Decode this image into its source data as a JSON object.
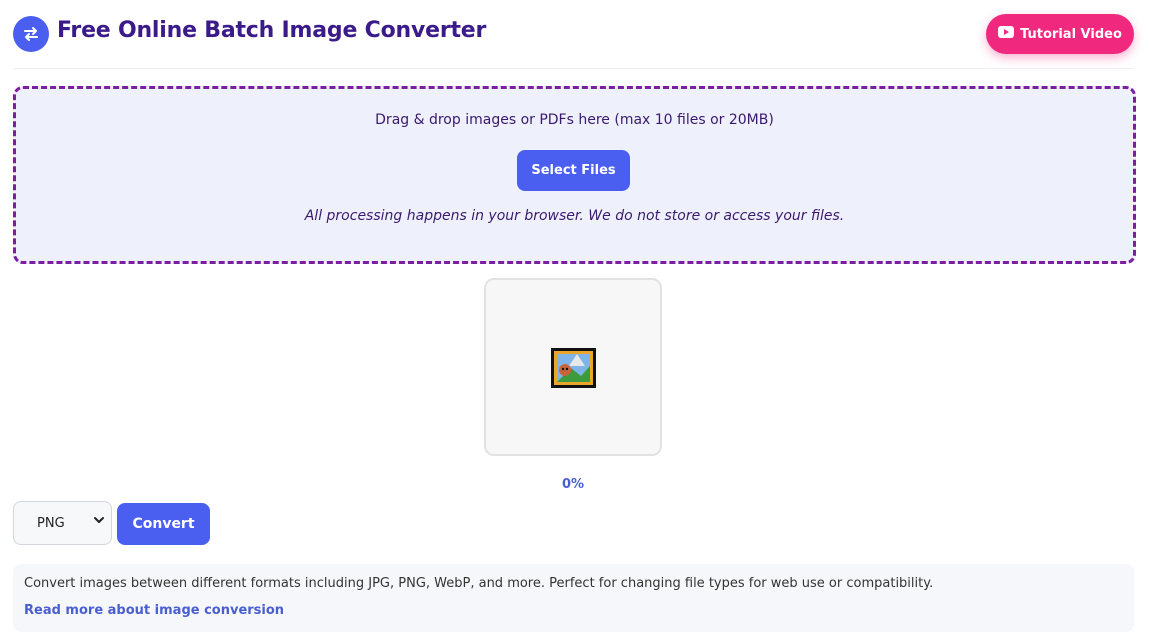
{
  "header": {
    "title": "Free Online Batch Image Converter",
    "tutorial_label": "Tutorial Video",
    "logo_icon": "swap-arrows-icon"
  },
  "dropzone": {
    "instruction": "Drag & drop images or PDFs here (max 10 files or 20MB)",
    "select_label": "Select Files",
    "privacy_note": "All processing happens in your browser. We do not store or access your files."
  },
  "preview": {
    "icon": "broken-image-icon",
    "progress_percent": 0,
    "progress_text": "0%"
  },
  "controls": {
    "format_selected": "PNG",
    "convert_label": "Convert"
  },
  "info": {
    "description": "Convert images between different formats including JPG, PNG, WebP, and more. Perfect for changing file types for web use or compatibility.",
    "link_text": "Read more about image conversion"
  },
  "colors": {
    "accent": "#4a5ff0",
    "title": "#3b1a8a",
    "tutorial": "#f0287e",
    "dropzone_border": "#7b1fa2",
    "dropzone_bg": "#eef0fc"
  }
}
